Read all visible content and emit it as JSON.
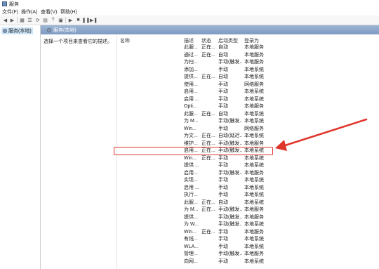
{
  "window": {
    "title": "服务"
  },
  "menu": [
    "文件(F)",
    "操作(A)",
    "查看(V)",
    "帮助(H)"
  ],
  "toolbar": {
    "icons": [
      "back-icon",
      "forward-icon",
      "view-icon",
      "list-icon",
      "refresh-icon",
      "properties-icon",
      "help-icon",
      "play-icon",
      "stop-icon",
      "pause-icon",
      "restart-icon"
    ]
  },
  "tree": {
    "root_label": "服务(本地)"
  },
  "header": {
    "title": "服务(本地)"
  },
  "details": {
    "prompt": "选择一个项目来查看它的描述。"
  },
  "columns": {
    "name": "名称",
    "desc": "描述",
    "status": "状态",
    "startup": "启动类型",
    "login": "登录为"
  },
  "services": [
    {
      "name": "Windows Event Log",
      "desc": "此服...",
      "status": "正在...",
      "startup": "自动",
      "login": "本地服务"
    },
    {
      "name": "Windows Font Cache Service",
      "desc": "通过...",
      "status": "正在...",
      "startup": "自动",
      "login": "本地服务"
    },
    {
      "name": "Windows Image Acquisitio...",
      "desc": "为扫...",
      "status": "",
      "startup": "手动(触发...",
      "login": "本地服务"
    },
    {
      "name": "Windows Installer",
      "desc": "添加...",
      "status": "",
      "startup": "手动",
      "login": "本地系统"
    },
    {
      "name": "Windows Management Inst...",
      "desc": "提供...",
      "status": "正在...",
      "startup": "自动",
      "login": "本地系统"
    },
    {
      "name": "Windows Media Player Net...",
      "desc": "使用...",
      "status": "",
      "startup": "手动",
      "login": "网络服务"
    },
    {
      "name": "Windows Mixed Reality Op...",
      "desc": "启用...",
      "status": "",
      "startup": "手动",
      "login": "本地系统"
    },
    {
      "name": "Windows Modules Installer",
      "desc": "启用 ...",
      "status": "",
      "startup": "手动",
      "login": "本地系统"
    },
    {
      "name": "Windows Presentation Fou...",
      "desc": "Opti...",
      "status": "",
      "startup": "手动",
      "login": "本地服务"
    },
    {
      "name": "Windows Push Notification...",
      "desc": "此服...",
      "status": "正在...",
      "startup": "自动",
      "login": "本地系统"
    },
    {
      "name": "Windows PushToInstall 服务",
      "desc": "为 M...",
      "status": "",
      "startup": "手动(触发...",
      "login": "本地系统"
    },
    {
      "name": "Windows Remote Manage...",
      "desc": "Win...",
      "status": "",
      "startup": "手动",
      "login": "网络服务"
    },
    {
      "name": "Windows Search",
      "desc": "为文...",
      "status": "正在...",
      "startup": "自动(延迟...",
      "login": "本地系统"
    },
    {
      "name": "Windows Time",
      "desc": "维护...",
      "status": "正在...",
      "startup": "手动(触发...",
      "login": "本地服务"
    },
    {
      "name": "Windows Update",
      "desc": "启用...",
      "status": "正在...",
      "startup": "手动(触发...",
      "login": "本地系统"
    },
    {
      "name": "Windows 安全中心服务",
      "desc": "Win...",
      "status": "正在...",
      "startup": "手动",
      "login": "本地系统"
    },
    {
      "name": "Windows 备份",
      "desc": "提供 ...",
      "status": "",
      "startup": "手动",
      "login": "本地系统"
    },
    {
      "name": "Windows 感知服务",
      "desc": "启用...",
      "status": "",
      "startup": "手动(触发...",
      "login": "本地服务"
    },
    {
      "name": "Windows 感知模拟服务",
      "desc": "实现...",
      "status": "",
      "startup": "手动",
      "login": "本地系统"
    },
    {
      "name": "Windows 更新医生服务",
      "desc": "启用 ...",
      "status": "",
      "startup": "手动",
      "login": "本地系统"
    },
    {
      "name": "Windows 管理服务",
      "desc": "执行...",
      "status": "",
      "startup": "手动",
      "login": "本地系统"
    },
    {
      "name": "Windows 推送通知系统服务",
      "desc": "此服...",
      "status": "正在...",
      "startup": "自动",
      "login": "本地系统"
    },
    {
      "name": "Windows 许可证管理器服务",
      "desc": "为 M...",
      "status": "正在...",
      "startup": "手动(触发...",
      "login": "本地服务"
    },
    {
      "name": "Windows 移动热点服务",
      "desc": "提供...",
      "status": "",
      "startup": "手动(触发...",
      "login": "本地服务"
    },
    {
      "name": "Windows 预览体验成员服务",
      "desc": "为 W...",
      "status": "",
      "startup": "手动(触发...",
      "login": "本地系统"
    },
    {
      "name": "WinHTTP Web Proxy Auto-...",
      "desc": "Win...",
      "status": "正在...",
      "startup": "手动",
      "login": "本地服务"
    },
    {
      "name": "Wired AutoConfig",
      "desc": "有线...",
      "status": "",
      "startup": "手动",
      "login": "本地系统"
    },
    {
      "name": "WLAN AutoConfig",
      "desc": "WLA...",
      "status": "",
      "startup": "手动",
      "login": "本地系统"
    },
    {
      "name": "WLAN Direct 服务连接管理...",
      "desc": "管理...",
      "status": "",
      "startup": "手动(触发...",
      "login": "本地服务"
    },
    {
      "name": "WMI Performance Adapter",
      "desc": "向网...",
      "status": "",
      "startup": "手动",
      "login": "本地系统"
    }
  ],
  "colors": {
    "highlight": "#e0352b",
    "arrow": "#e0352b",
    "header_bar": "#8aa6cc"
  }
}
